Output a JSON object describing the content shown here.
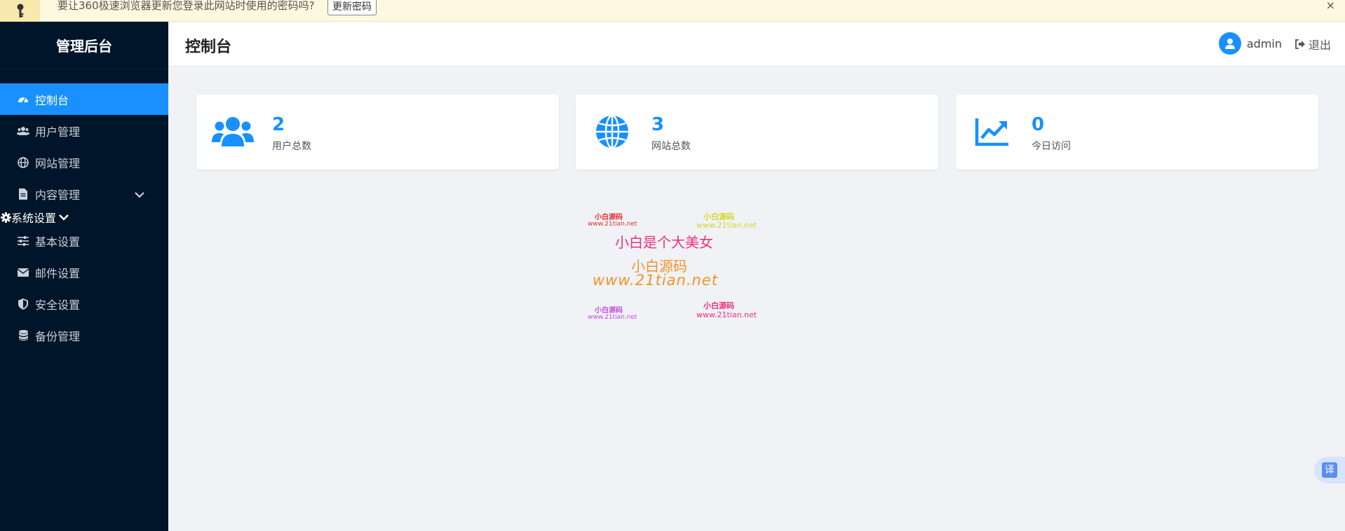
{
  "password_bar": {
    "message": "要让360极速浏览器更新您登录此网站时使用的密码吗?",
    "button": "更新密码",
    "close": "×"
  },
  "sidebar": {
    "brand": "管理后台",
    "items": [
      {
        "label": "控制台",
        "icon": "dashboard-icon",
        "active": true
      },
      {
        "label": "用户管理",
        "icon": "users-icon"
      },
      {
        "label": "网站管理",
        "icon": "globe-icon"
      },
      {
        "label": "内容管理",
        "icon": "file-icon",
        "expandable": true
      }
    ],
    "system_group": {
      "label": "系统设置",
      "icon": "gear-icon",
      "children": [
        {
          "label": "基本设置",
          "icon": "sliders-icon"
        },
        {
          "label": "邮件设置",
          "icon": "envelope-icon"
        },
        {
          "label": "安全设置",
          "icon": "shield-icon"
        },
        {
          "label": "备份管理",
          "icon": "database-icon"
        }
      ]
    }
  },
  "header": {
    "title": "控制台",
    "username": "admin",
    "logout": "退出"
  },
  "stats": [
    {
      "value": "2",
      "label": "用户总数",
      "icon": "users-icon"
    },
    {
      "value": "3",
      "label": "网站总数",
      "icon": "globe-icon"
    },
    {
      "value": "0",
      "label": "今日访问",
      "icon": "chart-line-icon"
    }
  ],
  "watermark": {
    "tl_title": "小白源码",
    "tl_url": "www.21tian.net",
    "tr_title": "小白源码",
    "tr_url": "www.21tian.net",
    "main": "小白是个大美女",
    "mid_title": "小白源码",
    "mid_url": "www.21tian.net",
    "bl_title": "小白源码",
    "bl_url": "www.21tian.net",
    "br_title": "小白源码",
    "br_url": "www.21tian.net"
  },
  "translate_button": "译",
  "colors": {
    "primary": "#1890ff",
    "sidebar_bg": "#001529",
    "page_bg": "#f0f2f5"
  }
}
